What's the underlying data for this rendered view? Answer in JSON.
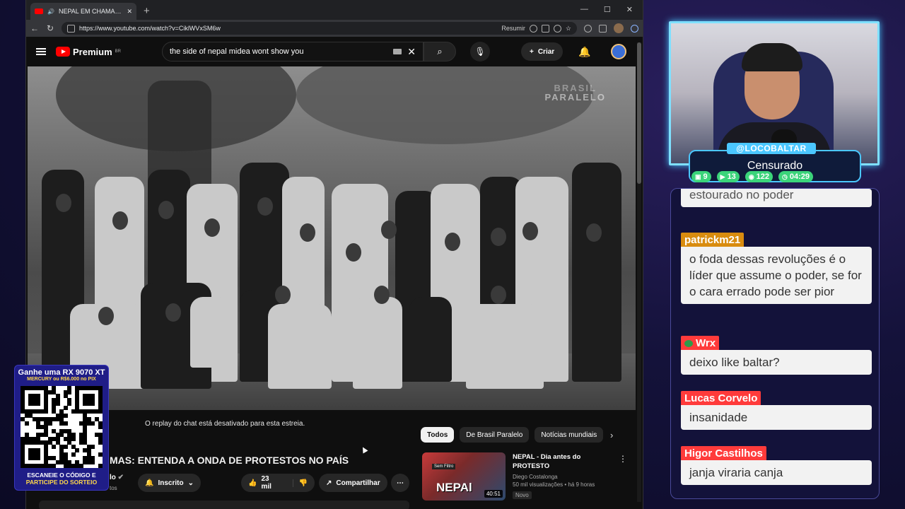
{
  "browser": {
    "tab_title": "NEPAL EM CHAMAS: ENTENDA",
    "url": "https://www.youtube.com/watch?v=CiklWVxSM6w",
    "summary_label": "Resumir",
    "window_controls": [
      "—",
      "☐",
      "✕"
    ]
  },
  "youtube": {
    "logo_text": "Premium",
    "logo_region": "BR",
    "search_value": "the side of nepal midea wont show you",
    "create_label": "Criar",
    "watermark_line1": "BRASIL",
    "watermark_line2": "PARALELO",
    "replay_notice": "O replay do chat está desativado para esta estreia.",
    "video_title": "MAS: ENTENDA A ONDA DE PROTESTOS NO PAÍS",
    "channel_name": "lo",
    "channel_sub": "tos",
    "subscribed_label": "Inscrito",
    "likes_label": "23 mil",
    "share_label": "Compartilhar",
    "chips": [
      "Todos",
      "De Brasil Paralelo",
      "Notícias mundiais"
    ],
    "recommendation": {
      "title": "NEPAL - Dia antes do PROTESTO",
      "channel": "Diego Costalonga",
      "meta": "50 mil visualizações • há 9 horas",
      "badge": "Novo",
      "duration": "40:51",
      "thumb_text": "NEPAl",
      "thumb_tag": "Sem Filtro"
    }
  },
  "stream": {
    "handle": "@LOCOBALTAR",
    "status": "Censurado",
    "stats": [
      {
        "icon": "twitch-icon",
        "value": "9"
      },
      {
        "icon": "youtube-icon",
        "value": "13"
      },
      {
        "icon": "kick-icon",
        "value": "122"
      },
      {
        "icon": "clock-icon",
        "value": "04:29"
      }
    ]
  },
  "chat": [
    {
      "user": "",
      "text": "estourado no poder",
      "partial": true
    },
    {
      "user": "patrickm21",
      "color": "gold",
      "text": "o foda dessas revoluções é o líder que assume o poder, se for o cara errado pode ser pior"
    },
    {
      "user": "Wrx",
      "emote": true,
      "text": "deixo like baltar?"
    },
    {
      "user": "Lucas Corvelo",
      "text": "insanidade"
    },
    {
      "user": "Higor Castilhos",
      "text": "janja viraria canja"
    }
  ],
  "promo": {
    "line1": "Ganhe uma RX 9070 XT",
    "line2": "MERCURY ou R$6.000 no PIX",
    "line3": "ESCANEIE O CÓDIGO E",
    "line4": "PARTICIPE DO SORTEIO"
  }
}
